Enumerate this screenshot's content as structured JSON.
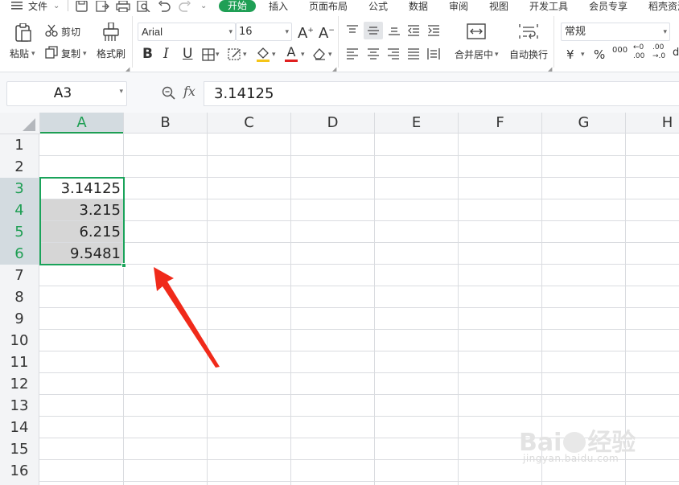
{
  "menu": {
    "file": "文件",
    "tabs": [
      "开始",
      "插入",
      "页面布局",
      "公式",
      "数据",
      "审阅",
      "视图",
      "开发工具",
      "会员专享",
      "稻壳资源"
    ],
    "active_tab": "开始"
  },
  "ribbon": {
    "paste": "粘贴",
    "cut": "剪切",
    "copy": "复制",
    "format_painter": "格式刷",
    "font_name": "Arial",
    "font_size": "16",
    "merge_center": "合并居中",
    "wrap_text": "自动换行",
    "number_format": "常规",
    "currency": "¥",
    "percent": "%",
    "thousands": "000",
    "inc_decimal_top": "←0",
    "inc_decimal_bot": ".00",
    "dec_decimal_top": ".00",
    "dec_decimal_bot": "→.0",
    "bold": "B",
    "italic": "I",
    "underline": "U",
    "font_color_letter": "A",
    "grow_font": "A",
    "shrink_font": "A",
    "more": "d"
  },
  "formula_bar": {
    "cell_ref": "A3",
    "fx": "fx",
    "content": "3.14125"
  },
  "sheet": {
    "columns": [
      "A",
      "B",
      "C",
      "D",
      "E",
      "F",
      "G",
      "H"
    ],
    "rows": [
      "1",
      "2",
      "3",
      "4",
      "5",
      "6",
      "7",
      "8",
      "9",
      "10",
      "11",
      "12",
      "13",
      "14",
      "15",
      "16"
    ],
    "cells": {
      "A3": "3.14125",
      "A4": "3.215",
      "A5": "6.215",
      "A6": "9.5481"
    },
    "selected_range": "A3:A6",
    "active_cell": "A3"
  },
  "watermark": {
    "brand": "Bai",
    "brand2": "经验",
    "url": "jingyan.baidu.com"
  },
  "colors": {
    "accent_green": "#1e9e53",
    "active_tab_bg": "#1f9f55",
    "selection_border": "#1aa35a",
    "arrow": "#f02a1a",
    "header_bg": "#f3f4f6",
    "gridline": "#dadce0"
  }
}
